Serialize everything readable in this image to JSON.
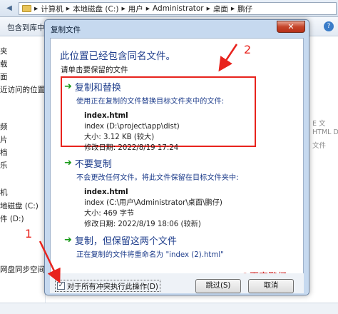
{
  "explorer": {
    "breadcrumb": [
      "计算机",
      "本地磁盘 (C:)",
      "用户",
      "Administrator",
      "桌面",
      "鹏仔"
    ],
    "toolbar_button": "包含到库中 ▼",
    "help_label": "?",
    "sidebar_items": [
      "夹",
      "载",
      "面",
      "近访问的位置",
      "频",
      "片",
      "档",
      "乐",
      "机",
      "地磁盘 (C:)",
      "件 (D:)",
      "网盘同步空间"
    ],
    "content_hints": [
      "E 文",
      "HTML D",
      "文件"
    ]
  },
  "dialog": {
    "title": "复制文件",
    "close_label": "✕",
    "heading": "此位置已经包含同名文件。",
    "subheading": "请单击要保留的文件",
    "options": [
      {
        "title": "复制和替换",
        "desc": "使用正在复制的文件替换目标文件夹中的文件:",
        "file_name": "index.html",
        "file_path": "index (D:\\project\\app\\dist)",
        "file_size": "大小: 3.12 KB (较大)",
        "file_modified": "修改日期: 2022/8/19 17:24"
      },
      {
        "title": "不要复制",
        "desc": "不会更改任何文件。将此文件保留在目标文件夹中:",
        "file_name": "index.html",
        "file_path": "index (C:\\用户\\Administrator\\桌面\\鹏仔)",
        "file_size": "大小: 469 字节",
        "file_modified": "修改日期: 2022/8/19 18:06 (较新)"
      },
      {
        "title": "复制，但保留这两个文件",
        "desc": "正在复制的文件将重命名为 \"index (2).html\""
      }
    ],
    "checkbox_label": "对于所有冲突执行此操作(D)",
    "checkbox_checked": "✓",
    "skip_button": "跳过(S)",
    "cancel_button": "取消"
  },
  "annotations": {
    "label_1": "1",
    "label_2": "2",
    "watermark": "@百变鹏仔",
    "color": "#e8231d"
  }
}
